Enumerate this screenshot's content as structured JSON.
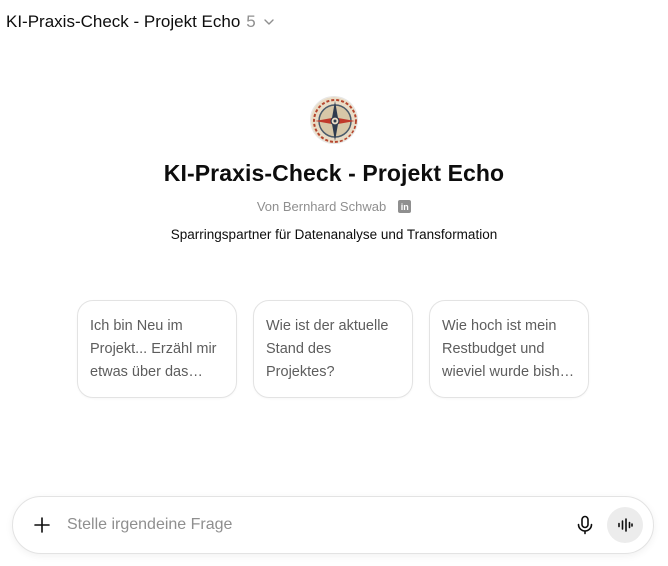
{
  "header": {
    "title": "KI-Praxis-Check - Projekt Echo",
    "version": "5"
  },
  "gpt": {
    "name": "KI-Praxis-Check - Projekt Echo",
    "byline": "Von Bernhard Schwab",
    "linkedin_icon": "linkedin-icon",
    "description": "Sparringspartner für Datenanalyse und Transformation"
  },
  "starters": [
    {
      "text": "Ich bin Neu im Projekt... Erzähl mir etwas über das Projekt"
    },
    {
      "text": "Wie ist der aktuelle Stand des Projektes?"
    },
    {
      "text": "Wie hoch ist mein Restbudget und wieviel wurde bisher ausgegeben?"
    }
  ],
  "composer": {
    "placeholder": "Stelle irgendeine Frage"
  },
  "colors": {
    "text": "#0d0d0d",
    "muted": "#8f8f8f",
    "border": "#e3e3e3",
    "voice_bg": "#ececec"
  }
}
